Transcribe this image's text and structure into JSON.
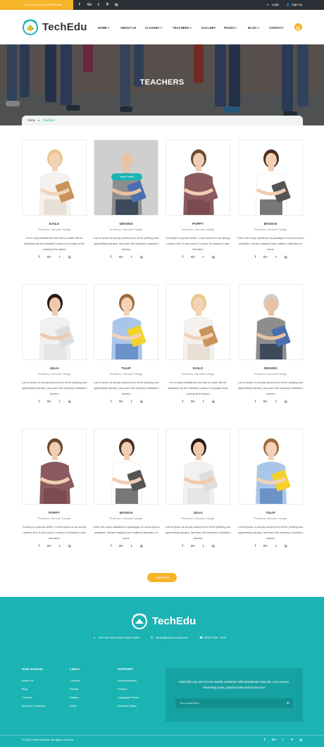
{
  "topbar": {
    "open_hours": "Open Hours: 8:00-16:30 Mon-Sat",
    "social": [
      "f",
      "G+",
      "t",
      "P",
      "ig"
    ],
    "login": "Login",
    "signup": "Sign Up"
  },
  "header": {
    "logo": "TechEdu",
    "nav": [
      "HOME",
      "ABOUT US",
      "CLASSES",
      "TEACHERS",
      "GALLERY",
      "PAGES",
      "BLOG",
      "CONTACT"
    ],
    "nav_has_dropdown": [
      true,
      false,
      true,
      true,
      false,
      true,
      true,
      false
    ],
    "active_nav": "TEACHERS"
  },
  "hero": {
    "title": "TEACHERS"
  },
  "breadcrumb": {
    "home": "Home",
    "current": "Teachers"
  },
  "teacher_role": "Professor, Harvard College",
  "view_profile": "View Profile",
  "teachers": [
    {
      "name": "KAILO",
      "desc": "It is a long established fact that a reader will be distracted by the readable content of a page when looking at its layout"
    },
    {
      "name": "GRAVES",
      "desc": "Lorem Ipsum is simply dummy text of the printing and typesetting industry, has been the industry's standard dummy"
    },
    {
      "name": "POPPY",
      "desc": "Contrary to popular belief, Lorem Ipsum is not simply random text. It has roots in a piece of classical Latin literature"
    },
    {
      "name": "MAOKAI",
      "desc": "There are many variations of passages of Lorem Ipsum available, but the majority have suffered alteration in some"
    },
    {
      "name": "JULIA",
      "desc": "Lorem Ipsum is simply dummy text of the printing and typesetting industry, has been the industry's standard dummy"
    },
    {
      "name": "TULIP",
      "desc": "Lorem Ipsum is simply dummy text of the printing and typesetting industry, has been the industry's standard dummy"
    },
    {
      "name": "KAILO",
      "desc": "It is a long established fact that a reader will be distracted by the readable content of a page when looking at its layout"
    },
    {
      "name": "GRAVES",
      "desc": "Lorem Ipsum is simply dummy text of the printing and typesetting industry, has been the industry's standard dummy"
    },
    {
      "name": "POPPY",
      "desc": "Contrary to popular belief, Lorem Ipsum is not simply random text. It has roots in a piece of classical Latin literature"
    },
    {
      "name": "MAOKAI",
      "desc": "There are many variations of passages of Lorem Ipsum available, but the majority have suffered alteration in some"
    },
    {
      "name": "JULIA",
      "desc": "Lorem Ipsum is simply dummy text of the printing and typesetting industry, has been the industry's standard dummy"
    },
    {
      "name": "TULIP",
      "desc": "Lorem Ipsum is simply dummy text of the printing and typesetting industry, has been the industry's standard dummy"
    }
  ],
  "card_social": [
    "f",
    "G+",
    "t",
    "ig"
  ],
  "load_more": "Load More",
  "footer": {
    "logo": "TechEdu",
    "address": "1st Floor New World Tower Miami",
    "email": "admin@power-boosts.com",
    "phone": "(800) 2345 - 6789",
    "school_heading": "OUR SCHOOL",
    "school_links": [
      "About Us",
      "Blog",
      "Contact",
      "Become a Teacher"
    ],
    "links_heading": "LINKS",
    "links": [
      "Courses",
      "Events",
      "Gallery",
      "FAQs"
    ],
    "support_heading": "SUPPORT",
    "support_links": [
      "Documentation",
      "Forums",
      "Language Packs",
      "Release Status"
    ],
    "newsletter_text": "Subscribe now and receive weekly newsletter with educational materials, new courses, interesting posts, popular books and much more!",
    "newsletter_placeholder": "Your email here",
    "copyright": "© 2016 Power-Boosts. All rights reserved",
    "social": [
      "f",
      "G+",
      "t",
      "P",
      "ig"
    ]
  },
  "colors": {
    "accent": "#1bb3b3",
    "yellow": "#f6b428",
    "dark": "#2a3036"
  }
}
